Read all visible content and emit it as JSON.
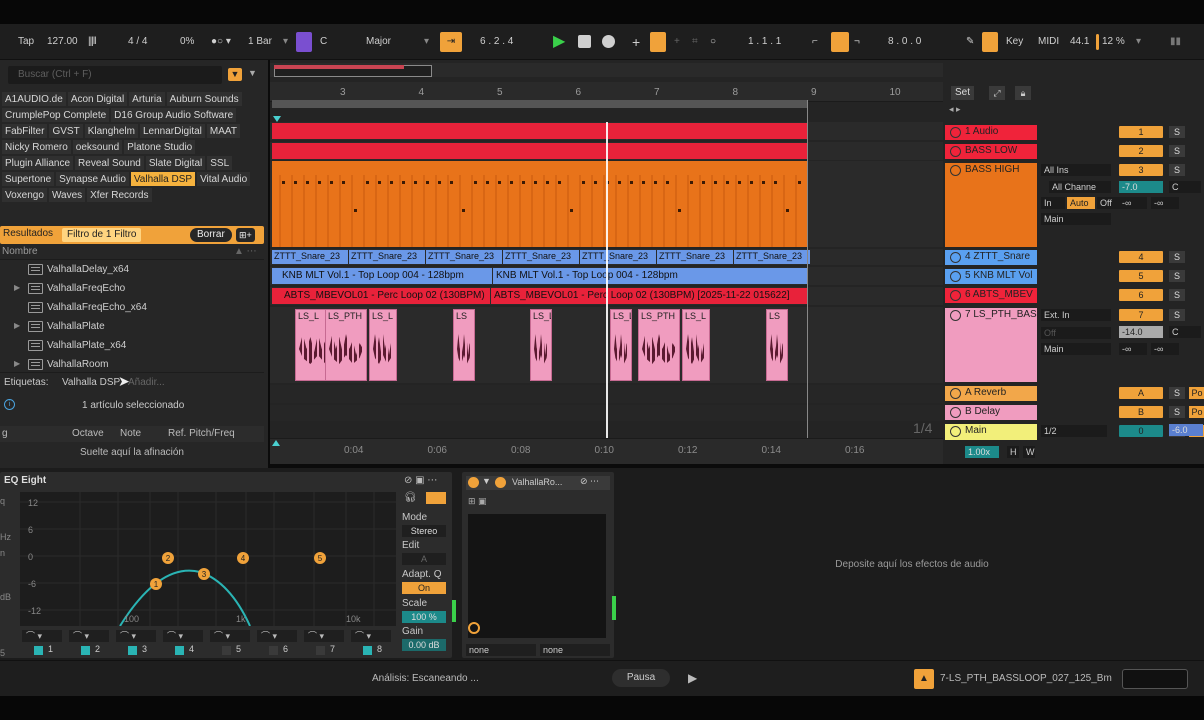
{
  "transport": {
    "tap": "Tap",
    "tempo": "127.00",
    "time_sig": "4 / 4",
    "swing": "0%",
    "quantize": "1 Bar",
    "key": "C",
    "scale": "Major",
    "position": "6 .  2 .  4",
    "loop_start": "1 .  1 .  1",
    "loop_length": "8 .  0 .  0",
    "key_label": "Key",
    "midi_label": "MIDI",
    "sample_rate": "44.1",
    "cpu": "12 %"
  },
  "browser": {
    "search_placeholder": "Buscar (Ctrl + F)",
    "tags": [
      "A1AUDIO.de",
      "Acon Digital",
      "Arturia",
      "Auburn Sounds",
      "CrumplePop Complete",
      "D16 Group Audio Software",
      "FabFilter",
      "GVST",
      "Klanghelm",
      "LennarDigital",
      "MAAT",
      "Nicky Romero",
      "oeksound",
      "Platone Studio",
      "Plugin Alliance",
      "Reveal Sound",
      "Slate Digital",
      "SSL",
      "Supertone",
      "Synapse Audio",
      "Valhalla DSP",
      "Vital Audio",
      "Voxengo",
      "Waves",
      "Xfer Records"
    ],
    "active_tag": "Valhalla DSP",
    "results_label": "Resultados",
    "filter_label": "Filtro de 1 Filtro",
    "clear_label": "Borrar",
    "name_header": "Nombre",
    "files": [
      "ValhallaDelay_x64",
      "ValhallaFreqEcho",
      "ValhallaFreqEcho_x64",
      "ValhallaPlate",
      "ValhallaPlate_x64",
      "ValhallaRoom"
    ],
    "tags_label": "Etiquetas:",
    "tags_value": "Valhalla DSP",
    "tags_add": "Añadir...",
    "selected_text": "1 artículo seleccionado",
    "tuning_headers": [
      "g",
      "Octave",
      "Note",
      "Ref. Pitch/Freq"
    ],
    "tuning_drop": "Suelte aquí la afinación"
  },
  "arrangement": {
    "bars": [
      "3",
      "4",
      "5",
      "6",
      "7",
      "8",
      "9",
      "10"
    ],
    "times": [
      "0:04",
      "0:06",
      "0:08",
      "0:10",
      "0:12",
      "0:14",
      "0:16"
    ],
    "zoom_fraction": "1/4",
    "snare_clip": "ZTTT_Snare_23",
    "knb_clips": [
      "KNB MLT Vol.1 - Top Loop 004 - 128bpm",
      "KNB MLT Vol.1 - Top Loop 004 - 128bpm"
    ],
    "perc_clips": [
      "ABTS_MBEVOL01 - Perc Loop 02 (130BPM)",
      "ABTS_MBEVOL01 - Perc Loop 02 (130BPM) [2025-11-22 015622]"
    ],
    "bass_clip_labels": [
      "LS_L",
      "LS_PTH",
      "LS_L",
      "LS",
      "LS_L",
      "LS_L",
      "LS_PTH",
      "LS_L",
      "LS"
    ]
  },
  "mixer": {
    "set_label": "Set",
    "tracks": [
      {
        "name": "1 Audio",
        "color": "#f0233a",
        "vol": "1"
      },
      {
        "name": "BASS LOW",
        "color": "#f0233a",
        "vol": "2"
      },
      {
        "name": "BASS HIGH",
        "color": "#e8731a",
        "vol": "3"
      },
      {
        "name": "4 ZTTT_Snare",
        "color": "#5aa0f0",
        "vol": "4"
      },
      {
        "name": "5 KNB MLT Vol",
        "color": "#5aa0f0",
        "vol": "5"
      },
      {
        "name": "6 ABTS_MBEV",
        "color": "#f0233a",
        "vol": "6"
      },
      {
        "name": "7 LS_PTH_BAS",
        "color": "#f09cbf",
        "vol": "7"
      },
      {
        "name": "A Reverb",
        "color": "#f2a74a",
        "vol": "A"
      },
      {
        "name": "B Delay",
        "color": "#f09cbf",
        "vol": "B"
      },
      {
        "name": "Main",
        "color": "#f2ef7a",
        "vol": "0"
      }
    ],
    "io_all_ins": "All Ins",
    "io_all_channels": "All Channe",
    "io_ext_in": "Ext. In",
    "io_main": "Main",
    "monitor": [
      "In",
      "Auto",
      "Off"
    ],
    "vol_values": {
      "bass_high": "-7.0",
      "bass_high_pan": "C",
      "ls_vol": "-14.0",
      "ls_pan": "C",
      "send_a": "-∞",
      "send_b": "-∞"
    },
    "main_ratio": "1/2",
    "main_zoom": "1.00x",
    "main_hw": [
      "H",
      "W"
    ],
    "main_vol": "-6.0",
    "solo": "S",
    "post": "Po"
  },
  "eq": {
    "title": "EQ Eight",
    "y_labels": [
      "12",
      "6",
      "0",
      "-6",
      "-12"
    ],
    "x_labels": [
      "100",
      "1k",
      "10k"
    ],
    "points": [
      "1",
      "2",
      "3",
      "4",
      "5"
    ],
    "mode_label": "Mode",
    "mode_value": "Stereo",
    "edit_label": "Edit",
    "edit_value": "A",
    "adapt_label": "Adapt. Q",
    "adapt_value": "On",
    "scale_label": "Scale",
    "scale_value": "100 %",
    "gain_label": "Gain",
    "gain_value": "0.00 dB",
    "band_nums": [
      "1",
      "2",
      "3",
      "4",
      "5",
      "6",
      "7",
      "8"
    ]
  },
  "valhalla": {
    "title": "ValhallaRo...",
    "selects": [
      "none",
      "none"
    ]
  },
  "drop_fx": "Deposite aquí los efectos de audio",
  "status": {
    "analysis": "Análisis: Escaneando ...",
    "pause": "Pausa",
    "clip": "7-LS_PTH_BASSLOOP_027_125_Bm"
  },
  "colors": {
    "accent": "#f0a23a",
    "red": "#f0233a",
    "orange": "#e8731a",
    "blue": "#5aa0f0",
    "pink": "#f09cbf"
  }
}
